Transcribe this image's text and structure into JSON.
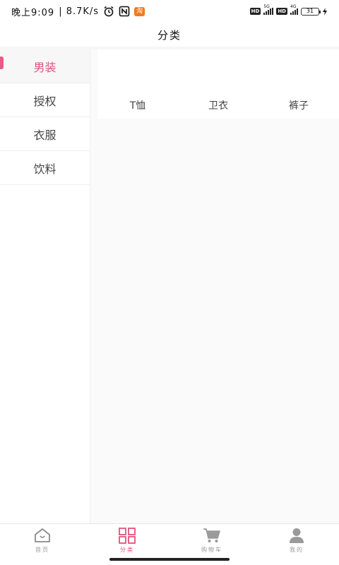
{
  "status_bar": {
    "time": "晚上9:09",
    "net_speed": "| 8.7K/s",
    "taobao_label": "淘",
    "hd1": "HD",
    "net1": "5G",
    "hd2": "HD",
    "net2": "4G",
    "battery_level": "31"
  },
  "header": {
    "title": "分类"
  },
  "sidebar": {
    "items": [
      {
        "label": "男装",
        "active": true
      },
      {
        "label": "授权",
        "active": false
      },
      {
        "label": "衣服",
        "active": false
      },
      {
        "label": "饮料",
        "active": false
      }
    ]
  },
  "content": {
    "sub_tabs": [
      {
        "label": "T恤"
      },
      {
        "label": "卫衣"
      },
      {
        "label": "裤子"
      }
    ]
  },
  "bottom_nav": {
    "items": [
      {
        "label": "首页",
        "icon": "home-icon"
      },
      {
        "label": "分类",
        "icon": "grid-icon",
        "active": true
      },
      {
        "label": "购物车",
        "icon": "cart-icon"
      },
      {
        "label": "我的",
        "icon": "user-icon"
      }
    ]
  },
  "colors": {
    "accent": "#e0527c",
    "inactive": "#9a9a9a"
  }
}
